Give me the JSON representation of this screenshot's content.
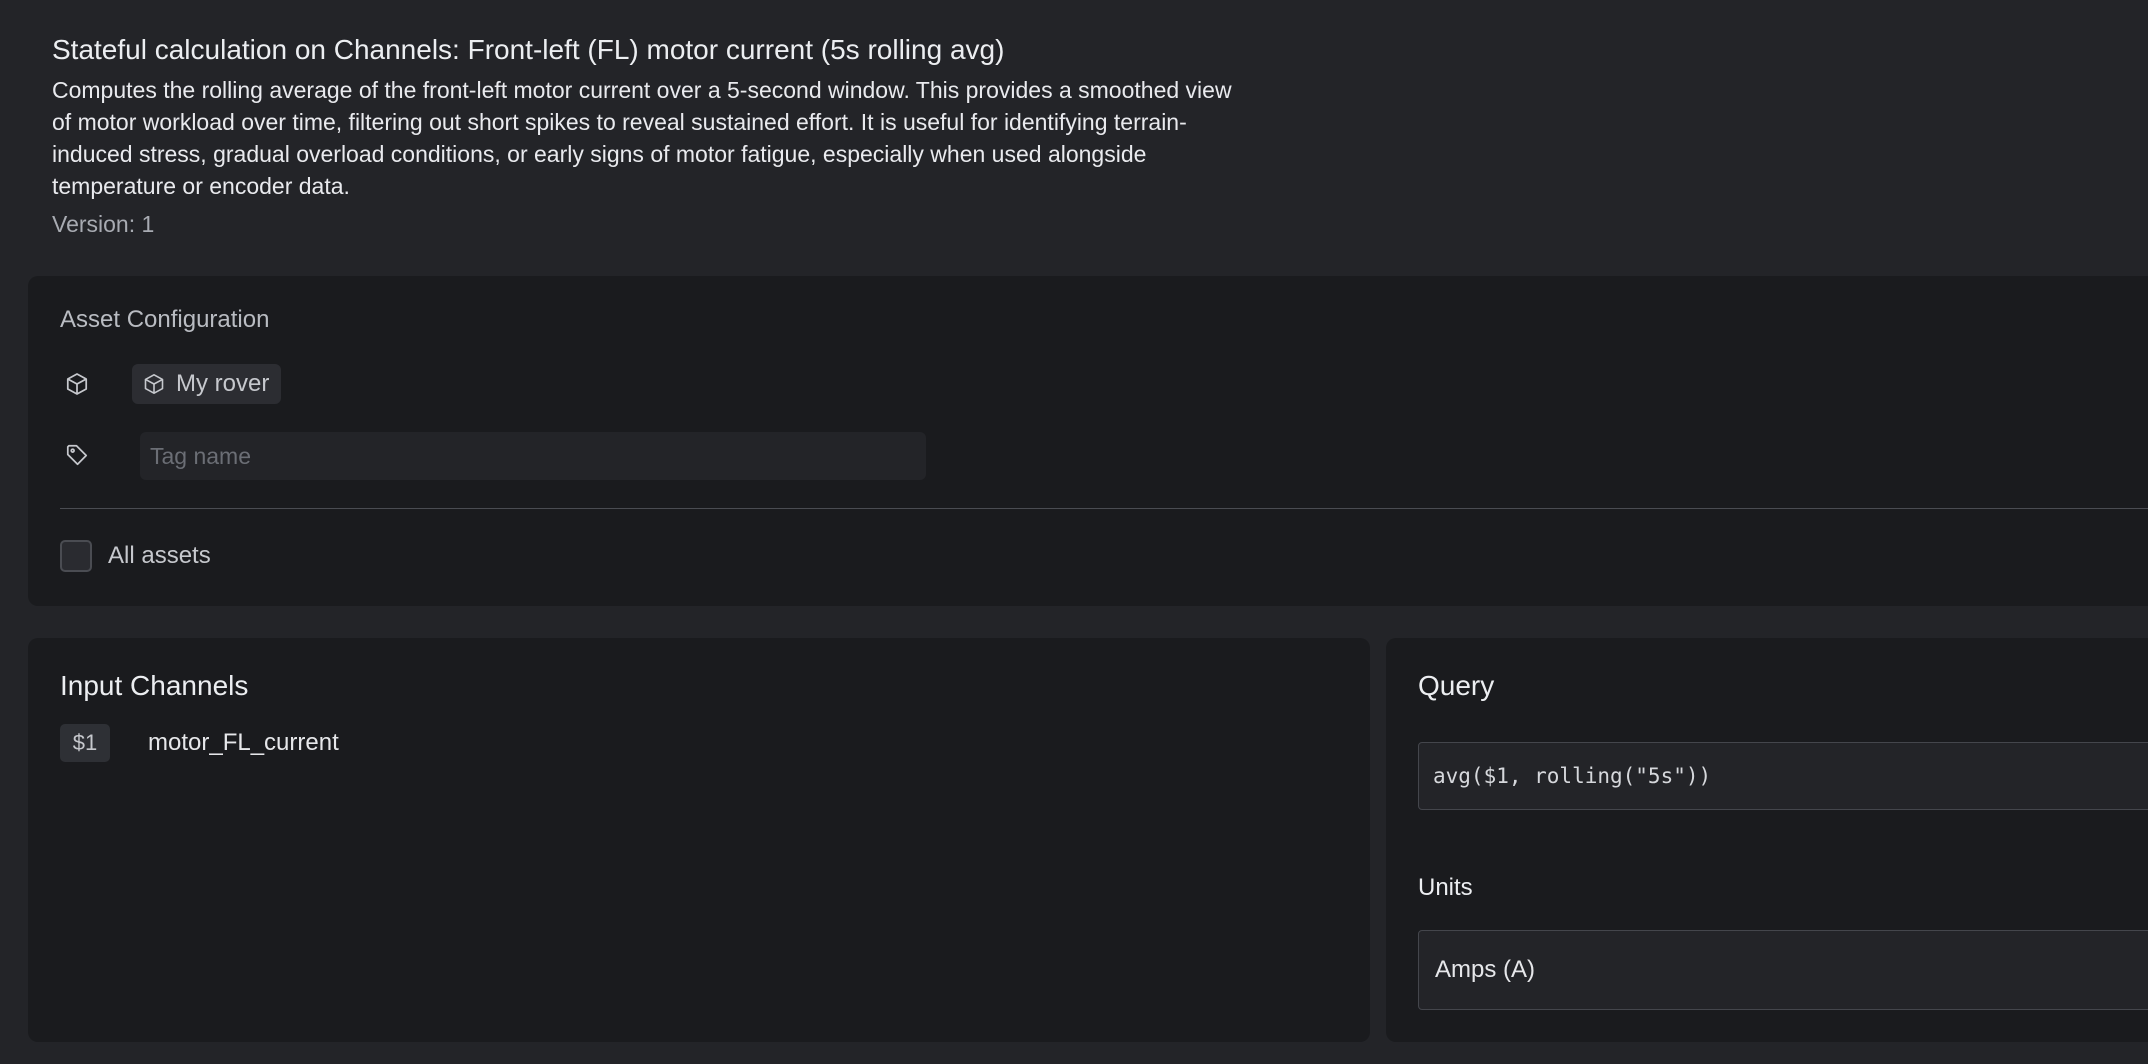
{
  "header": {
    "title": "Stateful calculation on Channels: Front-left (FL) motor current (5s rolling avg)",
    "description": "Computes the rolling average of the front-left motor current over a 5-second window. This provides a smoothed view of motor workload over time, filtering out short spikes to reveal sustained effort. It is useful for identifying terrain-induced stress, gradual overload conditions, or early signs of motor fatigue, especially when used alongside temperature or encoder data.",
    "version": "Version: 1"
  },
  "asset_configuration": {
    "label": "Asset Configuration",
    "asset_icon": "cube-icon",
    "tag_icon": "tag-icon",
    "selected_asset": "My rover",
    "tag_placeholder": "Tag name",
    "tag_value": "",
    "all_assets_label": "All assets",
    "all_assets_checked": false
  },
  "input_channels": {
    "heading": "Input Channels",
    "channels": [
      {
        "ref": "$1",
        "name": "motor_FL_current"
      }
    ]
  },
  "query": {
    "heading": "Query",
    "expression": "avg($1, rolling(\"5s\"))",
    "units_label": "Units",
    "units_value": "Amps (A)"
  }
}
